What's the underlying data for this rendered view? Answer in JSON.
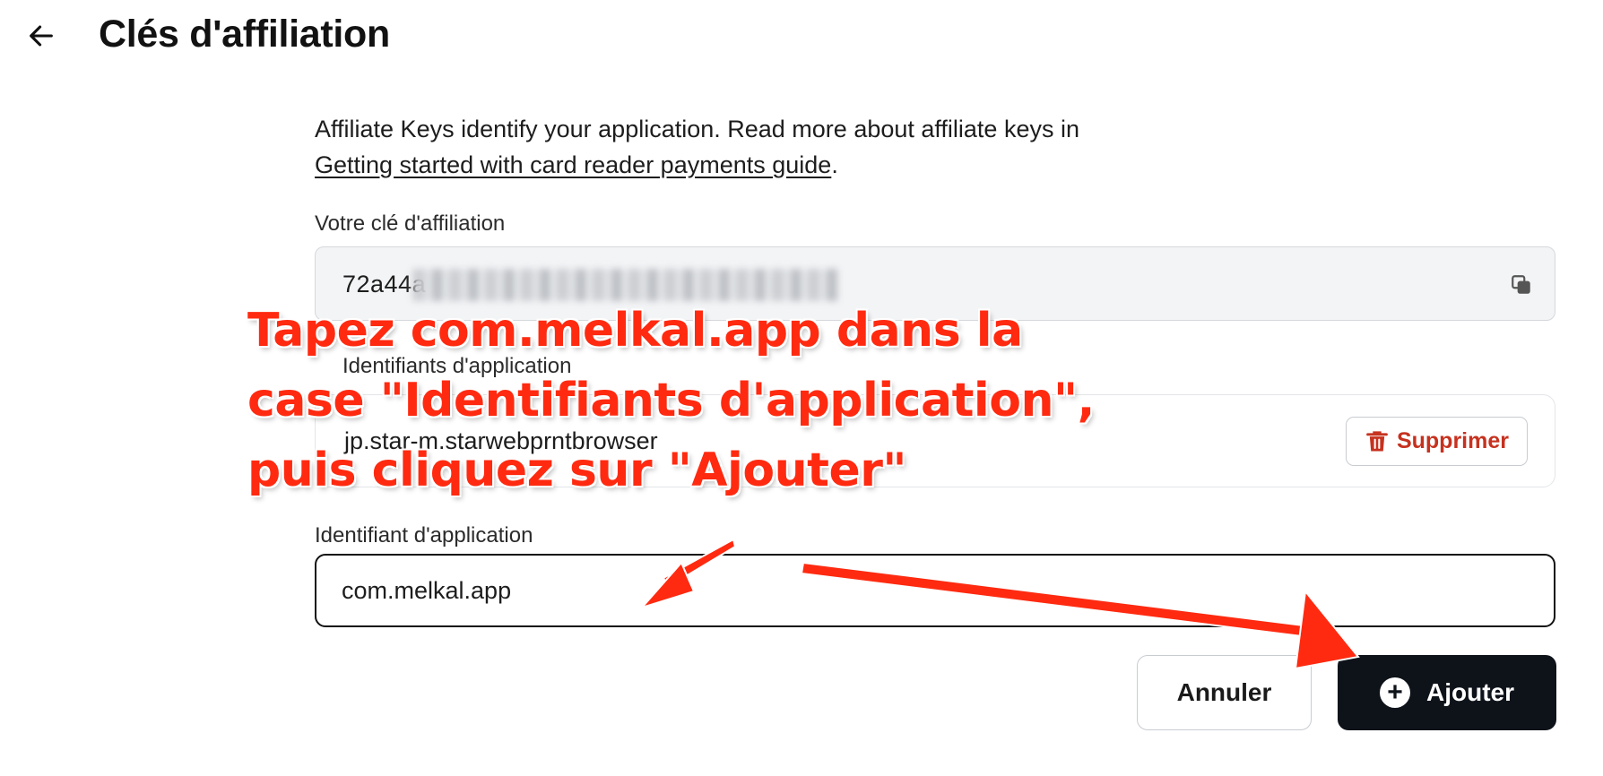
{
  "header": {
    "title": "Clés d'affiliation",
    "back_icon": "arrow-left-icon"
  },
  "intro": {
    "text": "Affiliate Keys identify your application. Read more about affiliate keys in",
    "link_text": "Getting started with card reader payments guide",
    "suffix": "."
  },
  "affiliate_key": {
    "label": "Votre clé d'affiliation",
    "value_visible": "72a44a",
    "copy_icon": "copy-icon"
  },
  "app_ids": {
    "label": "Identifiants d'application",
    "items": [
      {
        "value": "jp.star-m.starwebprntbrowser",
        "delete_label": "Supprimer",
        "delete_icon": "trash-icon"
      }
    ]
  },
  "new_app_id": {
    "label": "Identifiant d'application",
    "value": "com.melkal.app"
  },
  "actions": {
    "cancel_label": "Annuler",
    "add_label": "Ajouter",
    "add_icon": "plus-circle-icon"
  },
  "annotation": {
    "lines": [
      "Tapez com.melkal.app dans la",
      "case \"Identifiants d'application\",",
      "puis cliquez sur \"Ajouter\""
    ],
    "color": "#ff2a10"
  }
}
